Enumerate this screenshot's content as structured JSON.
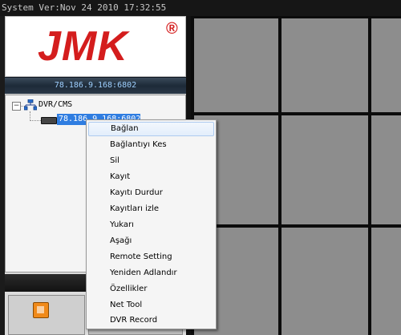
{
  "title_bar": "System Ver:Nov 24 2010 17:32:55",
  "logo": {
    "text": "JMK",
    "mark": "®",
    "color": "#d41d1d"
  },
  "server_address": "78.186.9.168:6802",
  "tree": {
    "root_label": "DVR/CMS",
    "root_toggle": "−",
    "child_label": "78.186.9.168:6802",
    "root_icon": "network-icon",
    "child_icon": "dvr-icon"
  },
  "context_menu": {
    "items": [
      "Bağlan",
      "Bağlantıyı Kes",
      "Sil",
      "Kayıt",
      "Kayıtı Durdur",
      "Kayıtları izle",
      "Yukarı",
      "Aşağı",
      "Remote Setting",
      "Yeniden Adlandır",
      "Özellikler",
      "Net Tool",
      "DVR Record"
    ],
    "highlighted_index": 0
  },
  "colors": {
    "selection": "#2f7de1",
    "video_cell": "#8d8d8d",
    "brand_red": "#d41d1d"
  }
}
